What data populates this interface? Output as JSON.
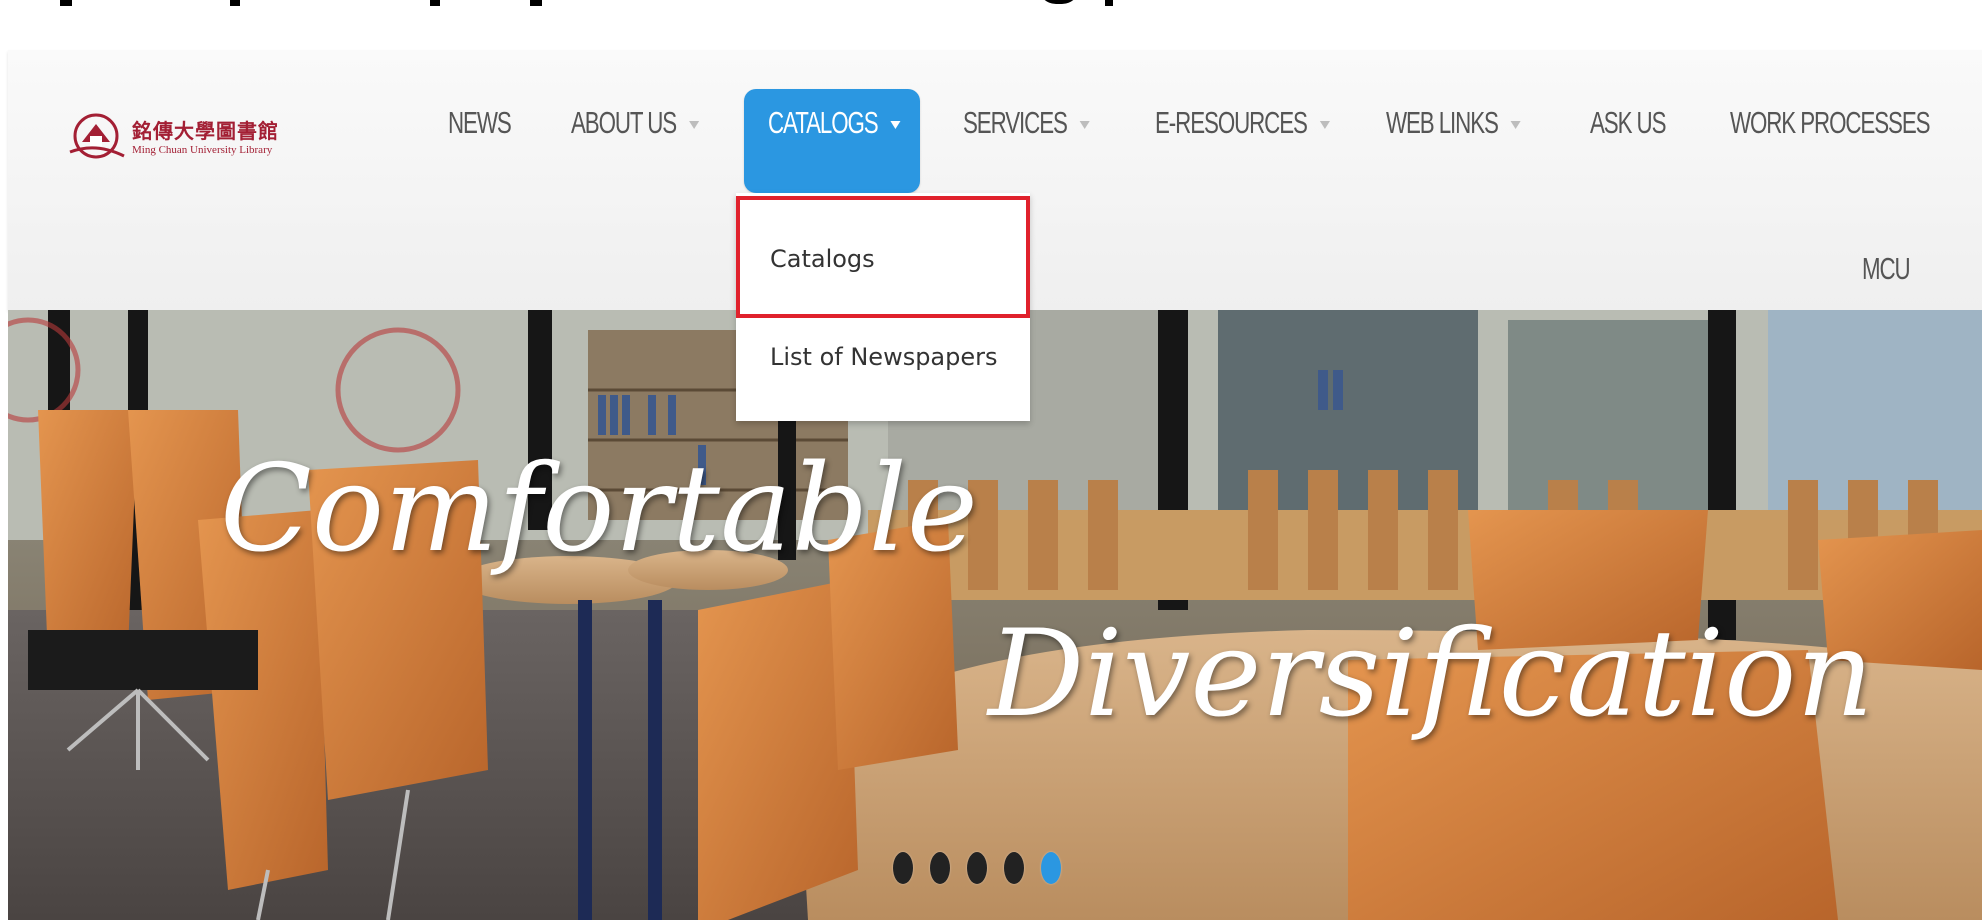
{
  "header": {
    "logo": {
      "chinese_name": "銘傳大學圖書館",
      "english_name": "Ming Chuan University Library"
    },
    "nav": [
      {
        "label": "NEWS",
        "has_dropdown": false
      },
      {
        "label": "ABOUT US",
        "has_dropdown": true
      },
      {
        "label": "CATALOGS",
        "has_dropdown": true,
        "active": true
      },
      {
        "label": "SERVICES",
        "has_dropdown": true
      },
      {
        "label": "E-RESOURCES",
        "has_dropdown": true
      },
      {
        "label": "WEB LINKS",
        "has_dropdown": true
      },
      {
        "label": "ASK US",
        "has_dropdown": false
      },
      {
        "label": "WORK PROCESSES",
        "has_dropdown": false
      },
      {
        "label": "MCU",
        "has_dropdown": false
      }
    ],
    "dropdown": {
      "items": [
        {
          "label": "Catalogs",
          "highlighted": true
        },
        {
          "label": "List of Newspapers"
        }
      ]
    }
  },
  "hero": {
    "line1": "Comfortable",
    "line2": "Diversification",
    "slides": {
      "count": 5,
      "active_index": 4
    }
  },
  "colors": {
    "accent": "#2b97e1",
    "highlight_border": "#e0212c",
    "logo": "#a31f34",
    "nav_text": "#555555"
  }
}
